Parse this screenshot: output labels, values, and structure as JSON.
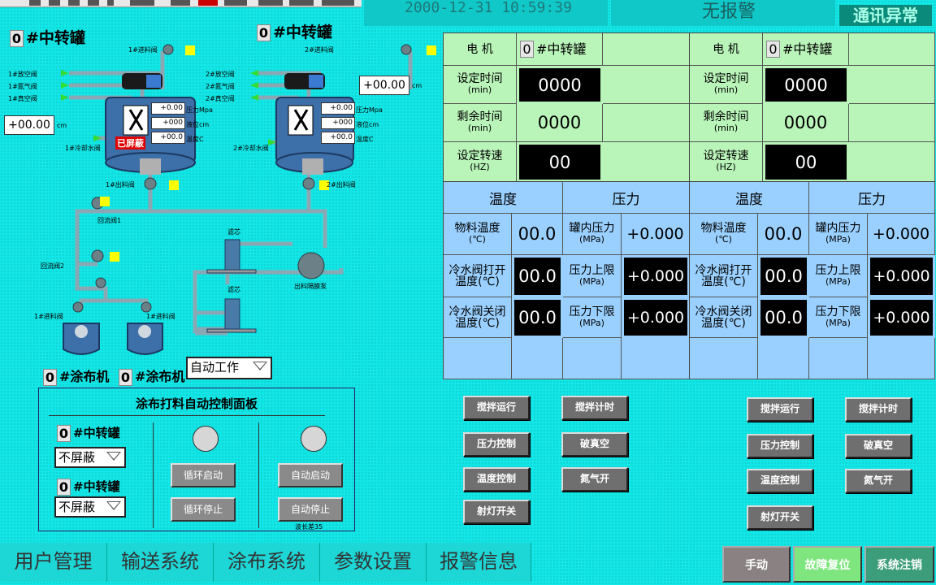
{
  "header": {
    "datetime": "2000-12-31 10:59:39",
    "alarm": "无报警",
    "comm": "通讯异常"
  },
  "left": {
    "tank1": {
      "num": "0",
      "title": "#中转罐"
    },
    "tank2": {
      "num": "0",
      "title": "#中转罐"
    },
    "tank1_labels": {
      "feed_valve": "1#进料阀",
      "vent": "1#放空阀",
      "nitrogen": "1#氮气阀",
      "vacuum": "1#真空阀",
      "cold_water": "1#冷却水阀",
      "outlet": "1#出料阀",
      "pressure": "压力Mpa",
      "level": "液位cm",
      "temp": "温度C",
      "val_pressure": "+0.00",
      "val_level": "+000",
      "val_temp": "+00.0",
      "shield": "已屏蔽",
      "level_big": "+00.00",
      "unit": "cm"
    },
    "tank2_labels": {
      "feed_valve": "2#进料阀",
      "vent": "2#放空阀",
      "nitrogen": "2#氮气阀",
      "vacuum": "2#真空阀",
      "cold_water": "2#冷却水阀",
      "outlet": "2#出料阀",
      "pressure": "压力Mpa",
      "level": "液位cm",
      "temp": "温度C",
      "val_pressure": "+0.00",
      "val_level": "+000",
      "val_temp": "+00.0",
      "level_big": "+00.00",
      "unit": "cm"
    },
    "return1": "回流阀1",
    "return2": "回流阀2",
    "filter1": "滤芯",
    "filter2": "滤芯",
    "pump": "出料隔膜泵",
    "coater_feed1": "1#进料阀",
    "coater_feed2": "1#进料阀",
    "coater1": {
      "num": "0",
      "label": "#涂布机"
    },
    "coater2": {
      "num": "0",
      "label": "#涂布机"
    },
    "mode_select": "自动工作"
  },
  "panel": {
    "title": "涂布打料自动控制面板",
    "tank_a": {
      "num": "0",
      "label": "#中转罐",
      "select": "不屏蔽"
    },
    "tank_b": {
      "num": "0",
      "label": "#中转罐",
      "select": "不屏蔽"
    },
    "cycle_start": "循环启动",
    "cycle_stop": "循环停止",
    "auto_start": "自动启动",
    "auto_stop": "自动停止",
    "footnote": "波长差35"
  },
  "motor_tables": [
    {
      "motor_label": "电    机",
      "num": "0",
      "tank": "#中转罐",
      "set_time_label": "设定时间",
      "set_time_unit": "(min)",
      "set_time": "0000",
      "remain_label": "剩余时间",
      "remain_unit": "(min)",
      "remain": "0000",
      "speed_label": "设定转速",
      "speed_unit": "(HZ)",
      "speed": "00"
    },
    {
      "motor_label": "电    机",
      "num": "0",
      "tank": "#中转罐",
      "set_time_label": "设定时间",
      "set_time_unit": "(min)",
      "set_time": "0000",
      "remain_label": "剩余时间",
      "remain_unit": "(min)",
      "remain": "0000",
      "speed_label": "设定转速",
      "speed_unit": "(HZ)",
      "speed": "00"
    }
  ],
  "temp_tables": [
    {
      "temp_hdr": "温度",
      "press_hdr": "压力",
      "mat_temp": "物料温度",
      "mat_temp_unit": "(℃)",
      "mat_temp_val": "00.0",
      "tank_press": "罐内压力",
      "tank_press_unit": "(MPa)",
      "tank_press_val": "+0.000",
      "cw_open": "冷水阀打开",
      "cw_open_unit": "温度(℃)",
      "cw_open_val": "00.0",
      "press_hi": "压力上限",
      "press_hi_unit": "(MPa)",
      "press_hi_val": "+0.000",
      "cw_close": "冷水阀关闭",
      "cw_close_unit": "温度(℃)",
      "cw_close_val": "00.0",
      "press_lo": "压力下限",
      "press_lo_unit": "(MPa)",
      "press_lo_val": "+0.000"
    },
    {
      "temp_hdr": "温度",
      "press_hdr": "压力",
      "mat_temp": "物料温度",
      "mat_temp_unit": "(℃)",
      "mat_temp_val": "00.0",
      "tank_press": "罐内压力",
      "tank_press_unit": "(MPa)",
      "tank_press_val": "+0.000",
      "cw_open": "冷水阀打开",
      "cw_open_unit": "温度(℃)",
      "cw_open_val": "00.0",
      "press_hi": "压力上限",
      "press_hi_unit": "(MPa)",
      "press_hi_val": "+0.000",
      "cw_close": "冷水阀关闭",
      "cw_close_unit": "温度(℃)",
      "cw_close_val": "00.0",
      "press_lo": "压力下限",
      "press_lo_unit": "(MPa)",
      "press_lo_val": "+0.000"
    }
  ],
  "control_buttons": {
    "stir_run": "搅拌运行",
    "stir_timer": "搅拌计时",
    "pressure_ctrl": "压力控制",
    "break_vacuum": "破真空",
    "temp_ctrl": "温度控制",
    "nitrogen_on": "氮气开",
    "light": "射灯开关"
  },
  "nav": [
    "用户管理",
    "输送系统",
    "涂布系统",
    "参数设置",
    "报警信息"
  ],
  "footer_buttons": {
    "manual": "手动",
    "fault_reset": "故障复位",
    "logout": "系统注销"
  },
  "colors": {
    "background": "#13e6e6",
    "table_green": "#b9f4b9",
    "table_blue": "#9ad0ff",
    "shield_red": "#e00000"
  }
}
